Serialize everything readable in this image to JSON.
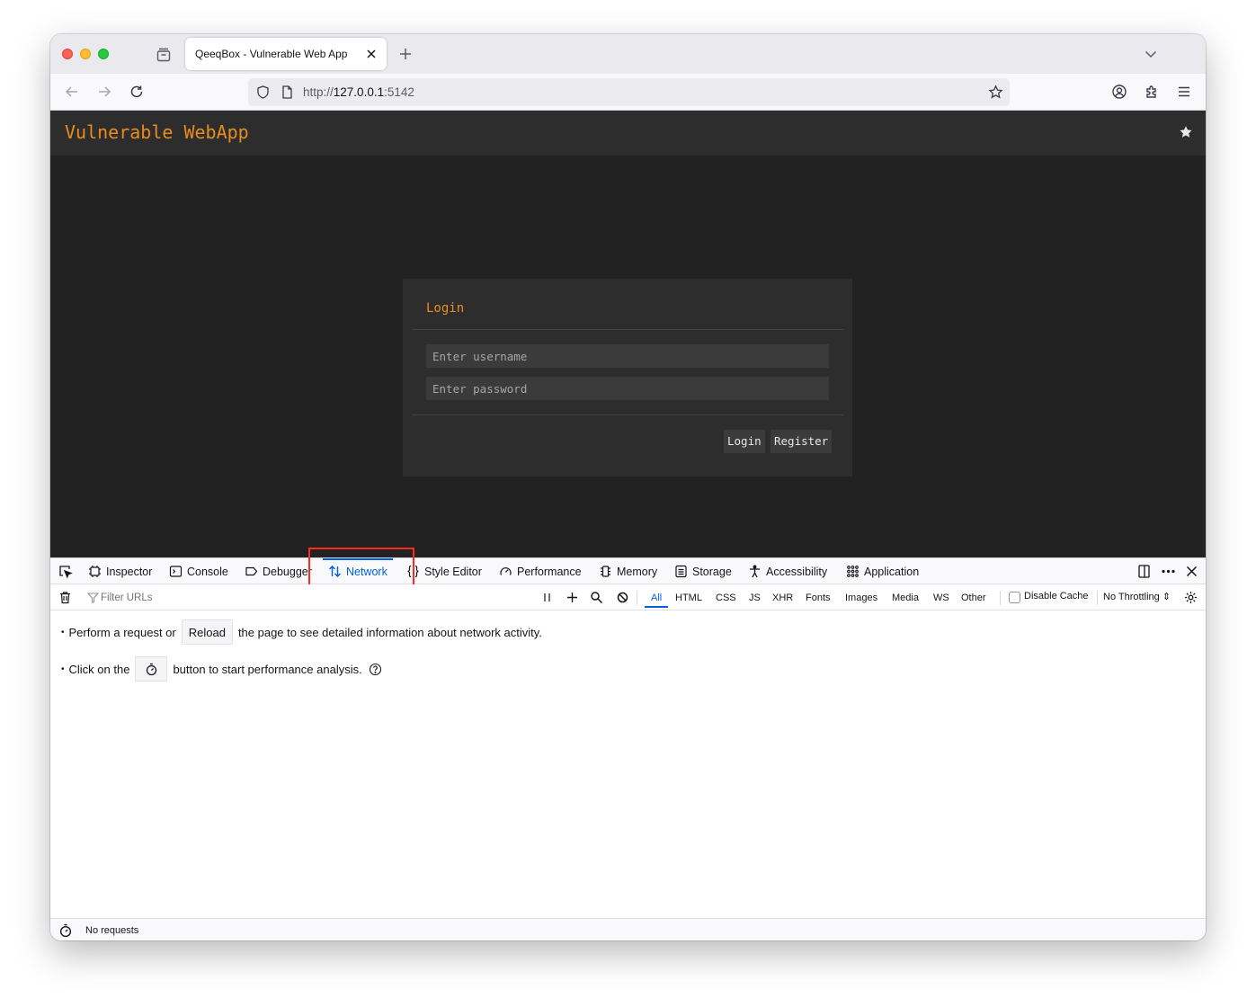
{
  "browser": {
    "tab_title": "QeeqBox - Vulnerable Web App",
    "url_scheme": "http://",
    "url_host": "127.0.0.1",
    "url_port": ":5142"
  },
  "site": {
    "title": "Vulnerable WebApp",
    "login": {
      "heading": "Login",
      "username_placeholder": "Enter username",
      "password_placeholder": "Enter password",
      "login_label": "Login",
      "register_label": "Register"
    }
  },
  "devtools": {
    "tabs": [
      {
        "label": "Inspector",
        "icon": "inspector-icon"
      },
      {
        "label": "Console",
        "icon": "console-icon"
      },
      {
        "label": "Debugger",
        "icon": "debugger-icon"
      },
      {
        "label": "Network",
        "icon": "network-icon",
        "selected": true
      },
      {
        "label": "Style Editor",
        "icon": "style-editor-icon"
      },
      {
        "label": "Performance",
        "icon": "performance-icon"
      },
      {
        "label": "Memory",
        "icon": "memory-icon"
      },
      {
        "label": "Storage",
        "icon": "storage-icon"
      },
      {
        "label": "Accessibility",
        "icon": "accessibility-icon"
      },
      {
        "label": "Application",
        "icon": "application-icon"
      }
    ],
    "filter_placeholder": "Filter URLs",
    "type_filters": [
      "All",
      "HTML",
      "CSS",
      "JS",
      "XHR",
      "Fonts",
      "Images",
      "Media",
      "WS",
      "Other"
    ],
    "disable_cache_label": "Disable Cache",
    "throttling_label": "No Throttling",
    "message1_before": "Perform a request or",
    "reload_label": "Reload",
    "message1_after": "the page to see detailed information about network activity.",
    "message2_before": "Click on the",
    "message2_after": "button to start performance analysis.",
    "status_text": "No requests",
    "accent_color": "#0060df",
    "highlight_color": "#ff2a1c"
  }
}
